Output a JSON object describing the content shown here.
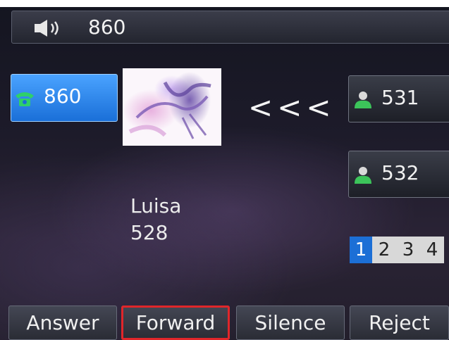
{
  "status_bar": {
    "number": "860",
    "icon": "speaker-icon"
  },
  "line": {
    "label": "860",
    "icon": "phone-icon",
    "color": "#1a6fd8"
  },
  "avatar": {
    "icon": "contact-photo"
  },
  "arrows": "<<<",
  "contacts": [
    {
      "label": "531",
      "icon": "person-icon"
    },
    {
      "label": "532",
      "icon": "person-icon"
    }
  ],
  "caller": {
    "name": "Luisa",
    "number": "528"
  },
  "pager": {
    "pages": [
      "1",
      "2",
      "3",
      "4"
    ],
    "active": "1"
  },
  "softkeys": {
    "answer": "Answer",
    "forward": "Forward",
    "silence": "Silence",
    "reject": "Reject"
  },
  "highlight_color": "#e0262a"
}
